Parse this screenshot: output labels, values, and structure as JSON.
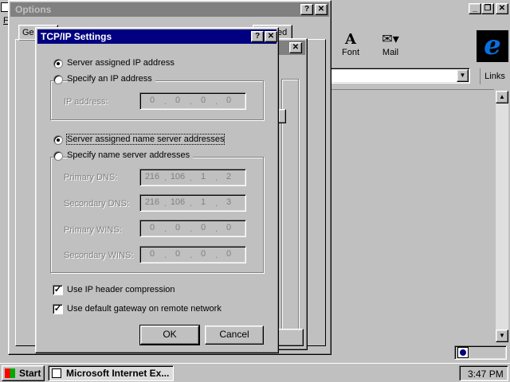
{
  "options_window": {
    "title": "Options",
    "tab_partial": "Ge",
    "tab_partial2": "ed",
    "menu_partial": "F"
  },
  "ie_window": {
    "toolbar": {
      "font_label": "Font",
      "mail_label": "Mail"
    },
    "links_label": "Links"
  },
  "dialog": {
    "title": "TCP/IP Settings",
    "ip_section": {
      "option_server": "Server assigned IP address",
      "option_specify": "Specify an IP address",
      "ip_label": "IP address:",
      "ip_value": [
        "0",
        "0",
        "0",
        "0"
      ]
    },
    "dns_section": {
      "option_server": "Server assigned name server addresses",
      "option_specify": "Specify name server addresses",
      "primary_dns_label": "Primary DNS:",
      "primary_dns": [
        "216",
        "106",
        "1",
        "2"
      ],
      "secondary_dns_label": "Secondary DNS:",
      "secondary_dns": [
        "216",
        "106",
        "1",
        "3"
      ],
      "primary_wins_label": "Primary WINS:",
      "primary_wins": [
        "0",
        "0",
        "0",
        "0"
      ],
      "secondary_wins_label": "Secondary WINS:",
      "secondary_wins": [
        "0",
        "0",
        "0",
        "0"
      ]
    },
    "use_ip_header_compression": "Use IP header compression",
    "use_default_gateway": "Use default gateway on remote network",
    "ok_label": "OK",
    "cancel_label": "Cancel",
    "selected_ip_option": "server",
    "selected_dns_option": "server",
    "ip_header_compression_checked": true,
    "default_gateway_checked": true
  },
  "taskbar": {
    "start_label": "Start",
    "task_label": "Microsoft Internet Ex...",
    "clock": "3:47 PM"
  }
}
